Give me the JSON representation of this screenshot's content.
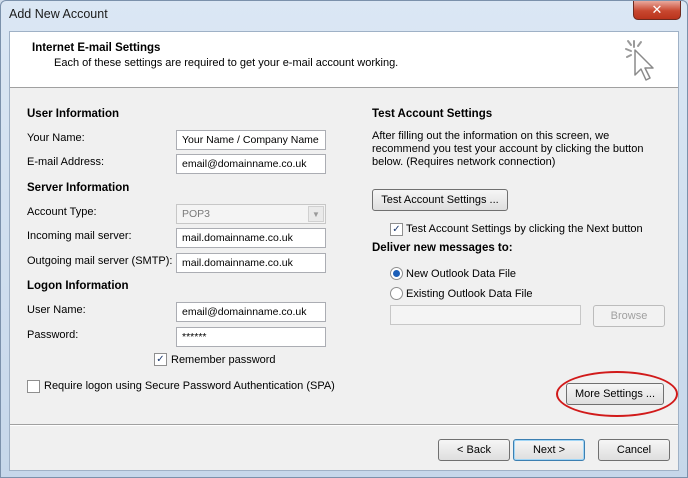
{
  "window": {
    "title": "Add New Account",
    "close_glyph": "✕"
  },
  "header": {
    "title": "Internet E-mail Settings",
    "subtitle": "Each of these settings are required to get your e-mail account working.",
    "icon": "wizard-cursor-icon"
  },
  "user_info": {
    "heading": "User Information",
    "your_name_label": "Your Name:",
    "your_name_value": "Your Name / Company Name",
    "email_label": "E-mail Address:",
    "email_value": "email@domainname.co.uk"
  },
  "server_info": {
    "heading": "Server Information",
    "account_type_label": "Account Type:",
    "account_type_value": "POP3",
    "incoming_label": "Incoming mail server:",
    "incoming_value": "mail.domainname.co.uk",
    "outgoing_label": "Outgoing mail server (SMTP):",
    "outgoing_value": "mail.domainname.co.uk"
  },
  "logon_info": {
    "heading": "Logon Information",
    "username_label": "User Name:",
    "username_value": "email@domainname.co.uk",
    "password_label": "Password:",
    "password_value": "******",
    "remember_label": "Remember password",
    "remember_checked": true,
    "spa_label": "Require logon using Secure Password Authentication (SPA)",
    "spa_checked": false
  },
  "test_settings": {
    "heading": "Test Account Settings",
    "instructions": "After filling out the information on this screen, we recommend you test your account by clicking the button below. (Requires network connection)",
    "test_button": "Test Account Settings ...",
    "auto_test_label": "Test Account Settings by clicking the Next button",
    "auto_test_checked": true
  },
  "deliver": {
    "heading": "Deliver new messages to:",
    "new_file_label": "New Outlook Data File",
    "existing_file_label": "Existing Outlook Data File",
    "selected": "new",
    "path_value": "",
    "browse_button": "Browse"
  },
  "more_settings_button": "More Settings ...",
  "footer": {
    "back_button": "< Back",
    "next_button": "Next >",
    "cancel_button": "Cancel"
  },
  "colors": {
    "highlight_ring": "#d11a1a",
    "close_button": "#c8472f"
  }
}
